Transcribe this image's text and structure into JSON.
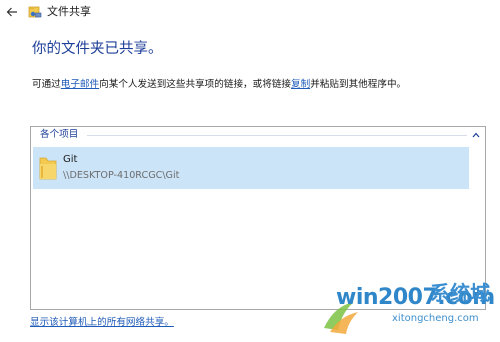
{
  "window": {
    "title": "文件共享"
  },
  "main": {
    "heading": "你的文件夹已共享。",
    "desc_prefix": "可通过",
    "desc_email_link": "电子邮件",
    "desc_middle": "向某个人发送到这些共享项的链接，或将链接",
    "desc_copy_link": "复制",
    "desc_suffix": "并粘贴到其他程序中。"
  },
  "list": {
    "group_label": "各个项目",
    "items": [
      {
        "name": "Git",
        "path": "\\\\DESKTOP-410RCGC\\Git"
      }
    ]
  },
  "footer": {
    "show_all_link": "显示该计算机上的所有网络共享。"
  },
  "watermark": {
    "main": "win2007.com",
    "cn": "系统城",
    "sub": "xitongcheng.com"
  },
  "icons": {
    "back": "back-arrow-icon",
    "title": "network-share-icon",
    "folder": "folder-icon",
    "chevron": "chevron-up-icon"
  },
  "colors": {
    "heading": "#1e3f99",
    "link": "#1f5bb8",
    "selection": "#cce4f7",
    "watermark": "#2f86c8"
  }
}
